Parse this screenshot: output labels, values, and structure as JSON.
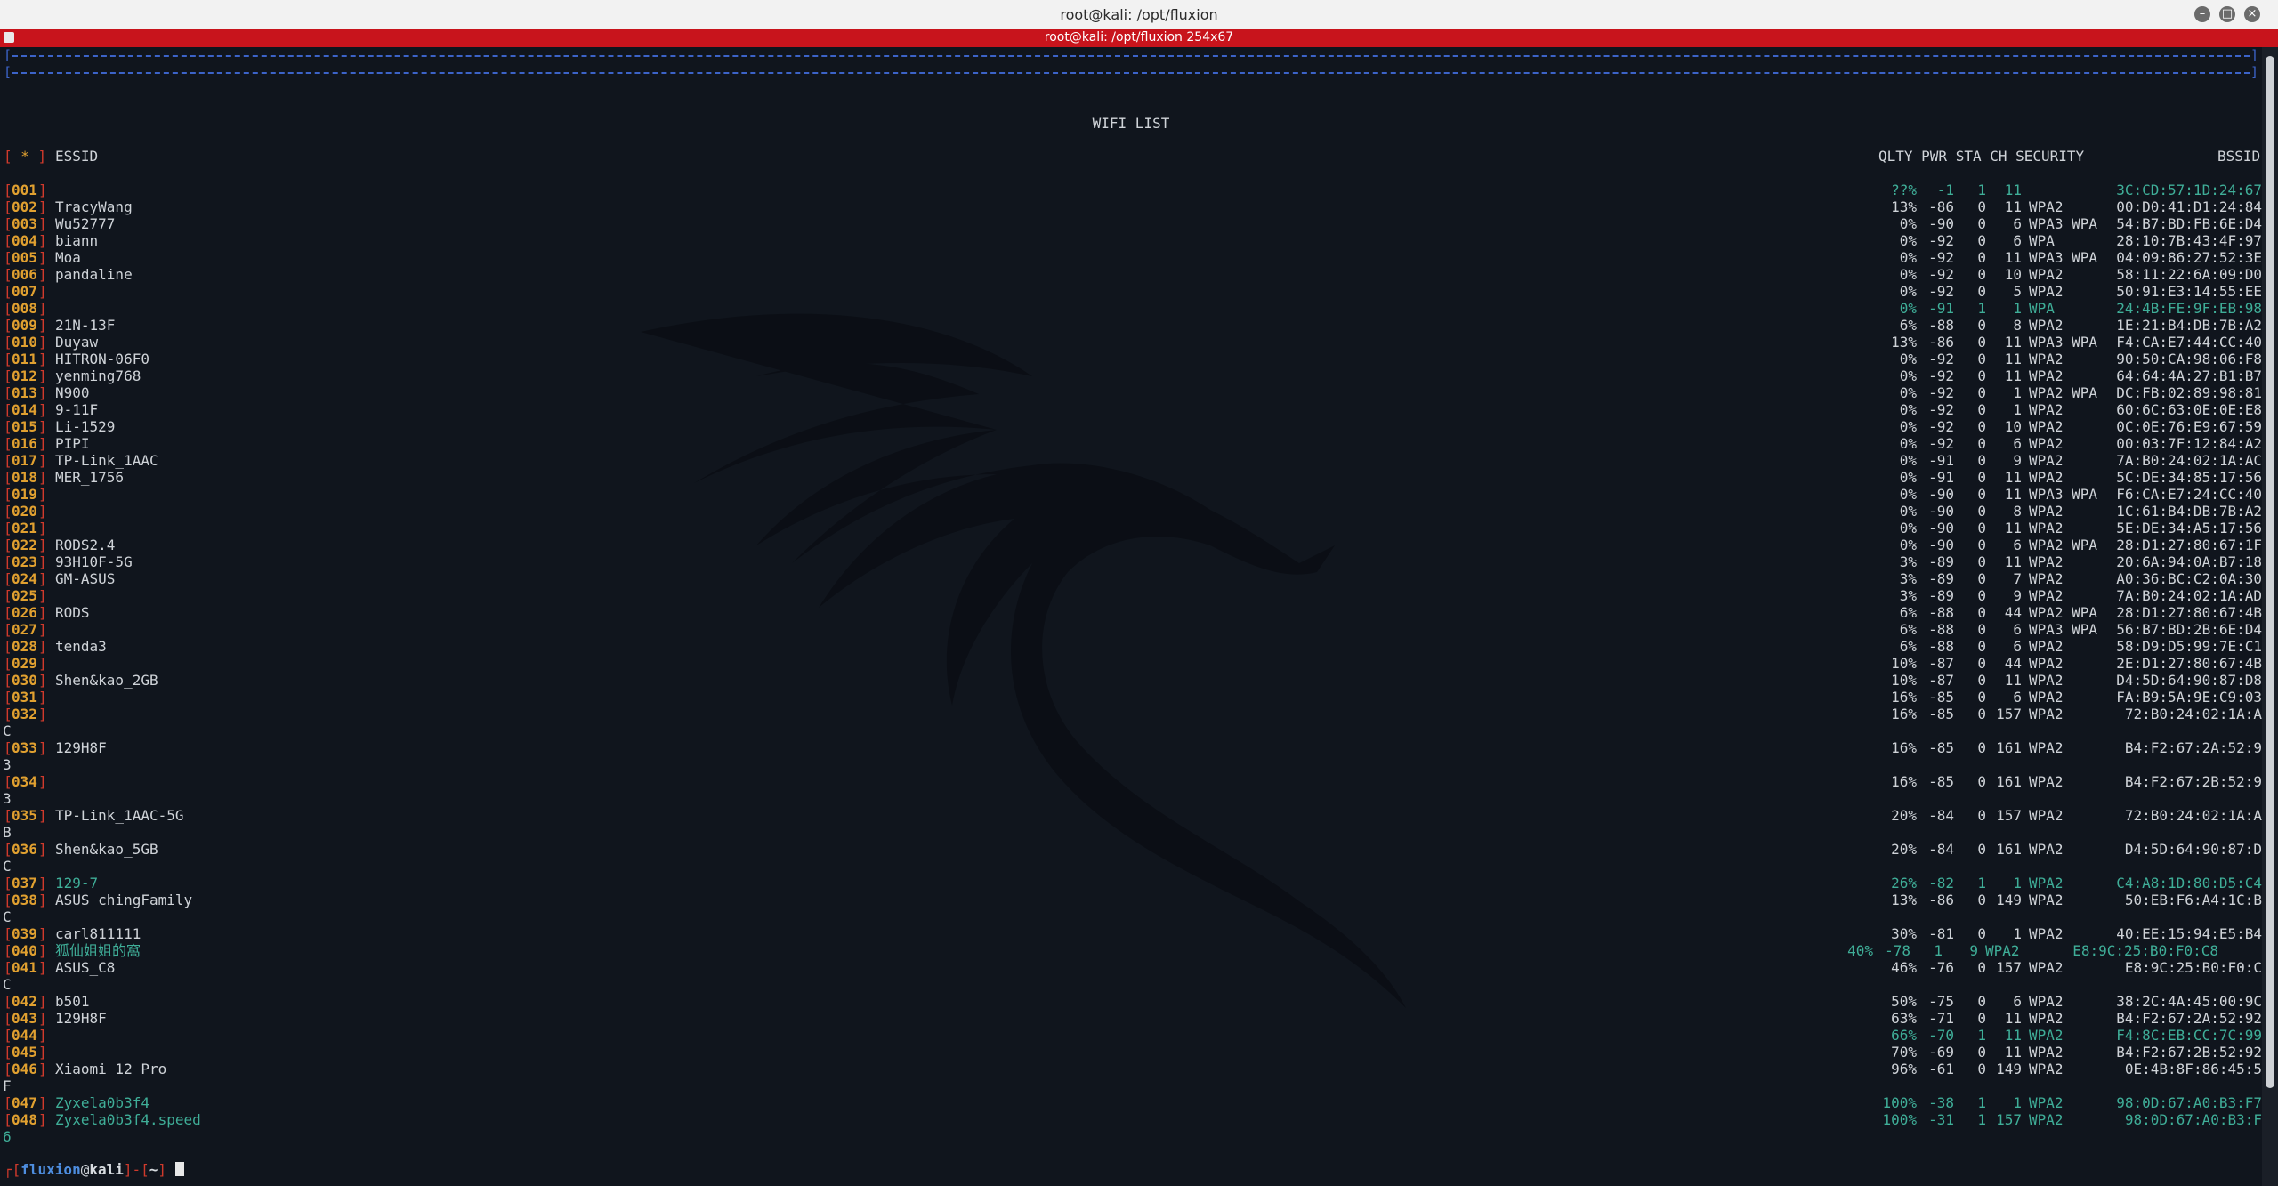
{
  "window": {
    "title": "root@kali: /opt/fluxion"
  },
  "tab": {
    "label": "root@kali: /opt/fluxion 254x67"
  },
  "screen": {
    "border_left": "[",
    "border_right": "]",
    "title": "WIFI LIST",
    "header": {
      "star": " * ",
      "essid": "ESSID",
      "cols": "QLTY PWR STA CH SECURITY",
      "bssid": "BSSID"
    }
  },
  "rows": [
    {
      "num": "001",
      "essid": "",
      "qlty": "??%",
      "pwr": "-1",
      "sta": "1",
      "ch": "11",
      "sec": "",
      "bssid": "3C:CD:57:1D:24:67",
      "green": true
    },
    {
      "num": "002",
      "essid": "TracyWang",
      "qlty": "13%",
      "pwr": "-86",
      "sta": "0",
      "ch": "11",
      "sec": "WPA2",
      "bssid": "00:D0:41:D1:24:84"
    },
    {
      "num": "003",
      "essid": "Wu52777",
      "qlty": "0%",
      "pwr": "-90",
      "sta": "0",
      "ch": "6",
      "sec": "WPA3 WPA",
      "bssid": "54:B7:BD:FB:6E:D4"
    },
    {
      "num": "004",
      "essid": "biann",
      "qlty": "0%",
      "pwr": "-92",
      "sta": "0",
      "ch": "6",
      "sec": "WPA",
      "bssid": "28:10:7B:43:4F:97"
    },
    {
      "num": "005",
      "essid": "Moa",
      "qlty": "0%",
      "pwr": "-92",
      "sta": "0",
      "ch": "11",
      "sec": "WPA3 WPA",
      "bssid": "04:09:86:27:52:3E"
    },
    {
      "num": "006",
      "essid": "pandaline",
      "qlty": "0%",
      "pwr": "-92",
      "sta": "0",
      "ch": "10",
      "sec": "WPA2",
      "bssid": "58:11:22:6A:09:D0"
    },
    {
      "num": "007",
      "essid": "",
      "qlty": "0%",
      "pwr": "-92",
      "sta": "0",
      "ch": "5",
      "sec": "WPA2",
      "bssid": "50:91:E3:14:55:EE"
    },
    {
      "num": "008",
      "essid": "",
      "qlty": "0%",
      "pwr": "-91",
      "sta": "1",
      "ch": "1",
      "sec": "WPA",
      "bssid": "24:4B:FE:9F:EB:98",
      "green": true
    },
    {
      "num": "009",
      "essid": "21N-13F",
      "qlty": "6%",
      "pwr": "-88",
      "sta": "0",
      "ch": "8",
      "sec": "WPA2",
      "bssid": "1E:21:B4:DB:7B:A2"
    },
    {
      "num": "010",
      "essid": "Duyaw",
      "qlty": "13%",
      "pwr": "-86",
      "sta": "0",
      "ch": "11",
      "sec": "WPA3 WPA",
      "bssid": "F4:CA:E7:44:CC:40"
    },
    {
      "num": "011",
      "essid": "HITRON-06F0",
      "qlty": "0%",
      "pwr": "-92",
      "sta": "0",
      "ch": "11",
      "sec": "WPA2",
      "bssid": "90:50:CA:98:06:F8"
    },
    {
      "num": "012",
      "essid": "yenming768",
      "qlty": "0%",
      "pwr": "-92",
      "sta": "0",
      "ch": "11",
      "sec": "WPA2",
      "bssid": "64:64:4A:27:B1:B7"
    },
    {
      "num": "013",
      "essid": "N900",
      "qlty": "0%",
      "pwr": "-92",
      "sta": "0",
      "ch": "1",
      "sec": "WPA2 WPA",
      "bssid": "DC:FB:02:89:98:81"
    },
    {
      "num": "014",
      "essid": "9-11F",
      "qlty": "0%",
      "pwr": "-92",
      "sta": "0",
      "ch": "1",
      "sec": "WPA2",
      "bssid": "60:6C:63:0E:0E:E8"
    },
    {
      "num": "015",
      "essid": "Li-1529",
      "qlty": "0%",
      "pwr": "-92",
      "sta": "0",
      "ch": "10",
      "sec": "WPA2",
      "bssid": "0C:0E:76:E9:67:59"
    },
    {
      "num": "016",
      "essid": "PIPI",
      "qlty": "0%",
      "pwr": "-92",
      "sta": "0",
      "ch": "6",
      "sec": "WPA2",
      "bssid": "00:03:7F:12:84:A2"
    },
    {
      "num": "017",
      "essid": "TP-Link_1AAC",
      "qlty": "0%",
      "pwr": "-91",
      "sta": "0",
      "ch": "9",
      "sec": "WPA2",
      "bssid": "7A:B0:24:02:1A:AC"
    },
    {
      "num": "018",
      "essid": "MER_1756",
      "qlty": "0%",
      "pwr": "-91",
      "sta": "0",
      "ch": "11",
      "sec": "WPA2",
      "bssid": "5C:DE:34:85:17:56"
    },
    {
      "num": "019",
      "essid": "",
      "qlty": "0%",
      "pwr": "-90",
      "sta": "0",
      "ch": "11",
      "sec": "WPA3 WPA",
      "bssid": "F6:CA:E7:24:CC:40"
    },
    {
      "num": "020",
      "essid": "",
      "qlty": "0%",
      "pwr": "-90",
      "sta": "0",
      "ch": "8",
      "sec": "WPA2",
      "bssid": "1C:61:B4:DB:7B:A2"
    },
    {
      "num": "021",
      "essid": "",
      "qlty": "0%",
      "pwr": "-90",
      "sta": "0",
      "ch": "11",
      "sec": "WPA2",
      "bssid": "5E:DE:34:A5:17:56"
    },
    {
      "num": "022",
      "essid": "RODS2.4",
      "qlty": "0%",
      "pwr": "-90",
      "sta": "0",
      "ch": "6",
      "sec": "WPA2 WPA",
      "bssid": "28:D1:27:80:67:1F"
    },
    {
      "num": "023",
      "essid": "93H10F-5G",
      "qlty": "3%",
      "pwr": "-89",
      "sta": "0",
      "ch": "11",
      "sec": "WPA2",
      "bssid": "20:6A:94:0A:B7:18"
    },
    {
      "num": "024",
      "essid": "GM-ASUS",
      "qlty": "3%",
      "pwr": "-89",
      "sta": "0",
      "ch": "7",
      "sec": "WPA2",
      "bssid": "A0:36:BC:C2:0A:30"
    },
    {
      "num": "025",
      "essid": "",
      "qlty": "3%",
      "pwr": "-89",
      "sta": "0",
      "ch": "9",
      "sec": "WPA2",
      "bssid": "7A:B0:24:02:1A:AD"
    },
    {
      "num": "026",
      "essid": "RODS",
      "qlty": "6%",
      "pwr": "-88",
      "sta": "0",
      "ch": "44",
      "sec": "WPA2 WPA",
      "bssid": "28:D1:27:80:67:4B"
    },
    {
      "num": "027",
      "essid": "",
      "qlty": "6%",
      "pwr": "-88",
      "sta": "0",
      "ch": "6",
      "sec": "WPA3 WPA",
      "bssid": "56:B7:BD:2B:6E:D4"
    },
    {
      "num": "028",
      "essid": "tenda3",
      "qlty": "6%",
      "pwr": "-88",
      "sta": "0",
      "ch": "6",
      "sec": "WPA2",
      "bssid": "58:D9:D5:99:7E:C1"
    },
    {
      "num": "029",
      "essid": "",
      "qlty": "10%",
      "pwr": "-87",
      "sta": "0",
      "ch": "44",
      "sec": "WPA2",
      "bssid": "2E:D1:27:80:67:4B"
    },
    {
      "num": "030",
      "essid": "Shen&kao_2GB",
      "qlty": "10%",
      "pwr": "-87",
      "sta": "0",
      "ch": "11",
      "sec": "WPA2",
      "bssid": "D4:5D:64:90:87:D8"
    },
    {
      "num": "031",
      "essid": "",
      "qlty": "16%",
      "pwr": "-85",
      "sta": "0",
      "ch": "6",
      "sec": "WPA2",
      "bssid": "FA:B9:5A:9E:C9:03"
    },
    {
      "num": "032",
      "essid": "",
      "qlty": "16%",
      "pwr": "-85",
      "sta": "0",
      "ch": "157",
      "sec": "WPA2",
      "bssid": "72:B0:24:02:1A:A",
      "wrap": "C"
    },
    {
      "num": "033",
      "essid": "129H8F",
      "qlty": "16%",
      "pwr": "-85",
      "sta": "0",
      "ch": "161",
      "sec": "WPA2",
      "bssid": "B4:F2:67:2A:52:9",
      "wrap": "3"
    },
    {
      "num": "034",
      "essid": "",
      "qlty": "16%",
      "pwr": "-85",
      "sta": "0",
      "ch": "161",
      "sec": "WPA2",
      "bssid": "B4:F2:67:2B:52:9",
      "wrap": "3"
    },
    {
      "num": "035",
      "essid": "TP-Link_1AAC-5G",
      "qlty": "20%",
      "pwr": "-84",
      "sta": "0",
      "ch": "157",
      "sec": "WPA2",
      "bssid": "72:B0:24:02:1A:A",
      "wrap": "B"
    },
    {
      "num": "036",
      "essid": "Shen&kao_5GB",
      "qlty": "20%",
      "pwr": "-84",
      "sta": "0",
      "ch": "161",
      "sec": "WPA2",
      "bssid": "D4:5D:64:90:87:D",
      "wrap": "C"
    },
    {
      "num": "037",
      "essid": "129-7",
      "qlty": "26%",
      "pwr": "-82",
      "sta": "1",
      "ch": "1",
      "sec": "WPA2",
      "bssid": "C4:A8:1D:80:D5:C4",
      "green": true
    },
    {
      "num": "038",
      "essid": "ASUS_chingFamily",
      "qlty": "13%",
      "pwr": "-86",
      "sta": "0",
      "ch": "149",
      "sec": "WPA2",
      "bssid": "50:EB:F6:A4:1C:B",
      "wrap": "C"
    },
    {
      "num": "039",
      "essid": "carl811111",
      "qlty": "30%",
      "pwr": "-81",
      "sta": "0",
      "ch": "1",
      "sec": "WPA2",
      "bssid": "40:EE:15:94:E5:B4"
    },
    {
      "num": "040",
      "essid": "狐仙姐姐的窩",
      "qlty": "40%",
      "pwr": "-78",
      "sta": "1",
      "ch": "9",
      "sec": "WPA2",
      "bssid": "E8:9C:25:B0:F0:C8",
      "green": true,
      "shift": true
    },
    {
      "num": "041",
      "essid": "ASUS_C8",
      "qlty": "46%",
      "pwr": "-76",
      "sta": "0",
      "ch": "157",
      "sec": "WPA2",
      "bssid": "E8:9C:25:B0:F0:C",
      "wrap": "C"
    },
    {
      "num": "042",
      "essid": "b501",
      "qlty": "50%",
      "pwr": "-75",
      "sta": "0",
      "ch": "6",
      "sec": "WPA2",
      "bssid": "38:2C:4A:45:00:9C"
    },
    {
      "num": "043",
      "essid": "129H8F",
      "qlty": "63%",
      "pwr": "-71",
      "sta": "0",
      "ch": "11",
      "sec": "WPA2",
      "bssid": "B4:F2:67:2A:52:92"
    },
    {
      "num": "044",
      "essid": "",
      "qlty": "66%",
      "pwr": "-70",
      "sta": "1",
      "ch": "11",
      "sec": "WPA2",
      "bssid": "F4:8C:EB:CC:7C:99",
      "green": true
    },
    {
      "num": "045",
      "essid": "",
      "qlty": "70%",
      "pwr": "-69",
      "sta": "0",
      "ch": "11",
      "sec": "WPA2",
      "bssid": "B4:F2:67:2B:52:92"
    },
    {
      "num": "046",
      "essid": "Xiaomi 12 Pro",
      "qlty": "96%",
      "pwr": "-61",
      "sta": "0",
      "ch": "149",
      "sec": "WPA2",
      "bssid": "0E:4B:8F:86:45:5",
      "wrap": "F"
    },
    {
      "num": "047",
      "essid": "Zyxela0b3f4",
      "qlty": "100%",
      "pwr": "-38",
      "sta": "1",
      "ch": "1",
      "sec": "WPA2",
      "bssid": "98:0D:67:A0:B3:F7",
      "green": true
    },
    {
      "num": "048",
      "essid": "Zyxela0b3f4.speed",
      "qlty": "100%",
      "pwr": "-31",
      "sta": "1",
      "ch": "157",
      "sec": "WPA2",
      "bssid": "98:0D:67:A0:B3:F",
      "wrap": "6",
      "green": true
    }
  ],
  "prompt": {
    "user": "fluxion",
    "at": "@",
    "host": "kali",
    "path": "~"
  },
  "colors": {
    "background": "#10151d",
    "row_number": "#e0a030",
    "bracket": "#d03a2c",
    "active": "#3fae98",
    "border": "#3c63c8",
    "tab": "#c8141c"
  }
}
